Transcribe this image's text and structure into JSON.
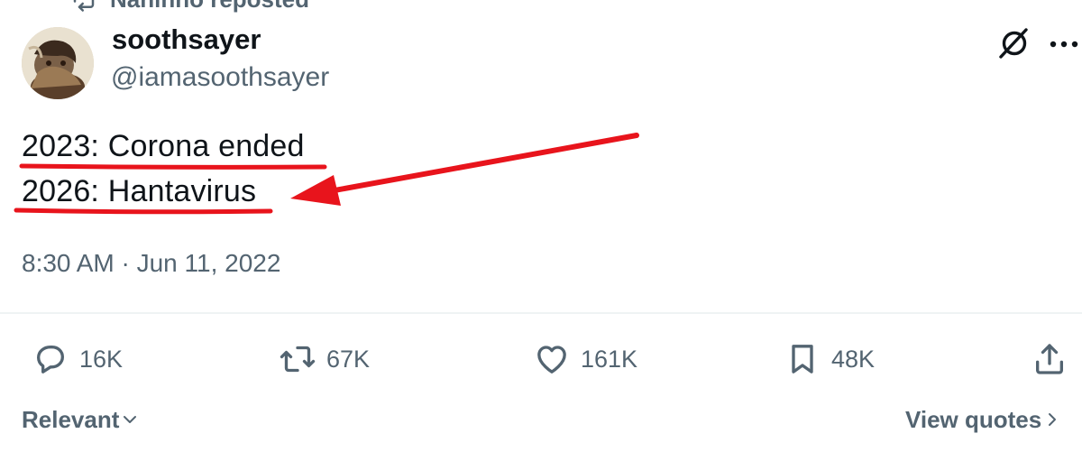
{
  "repost": {
    "text": "Naninno reposted",
    "icon": "repost-icon"
  },
  "author": {
    "display_name": "soothsayer",
    "handle": "@iamasoothsayer",
    "avatar_icon": "avatar"
  },
  "header_icons": [
    "grok-icon",
    "more-icon"
  ],
  "tweet": {
    "line1": "2023: Corona ended",
    "line2": "2026: Hantavirus"
  },
  "annotation": {
    "color": "#e8141c",
    "type": "red underlines and arrow pointing at second line"
  },
  "timestamp": "8:30 AM · Jun 11, 2022",
  "actions": {
    "reply": {
      "count": "16K",
      "icon": "reply-icon"
    },
    "retweet": {
      "count": "67K",
      "icon": "retweet-icon"
    },
    "like": {
      "count": "161K",
      "icon": "heart-icon"
    },
    "bookmark": {
      "count": "48K",
      "icon": "bookmark-icon"
    },
    "share": {
      "icon": "share-icon"
    }
  },
  "footer": {
    "sort_label": "Relevant",
    "view_quotes_label": "View quotes"
  },
  "colors": {
    "text_primary": "#0f1419",
    "text_secondary": "#536471",
    "annotation_red": "#e8141c",
    "divider": "#eff3f4"
  }
}
